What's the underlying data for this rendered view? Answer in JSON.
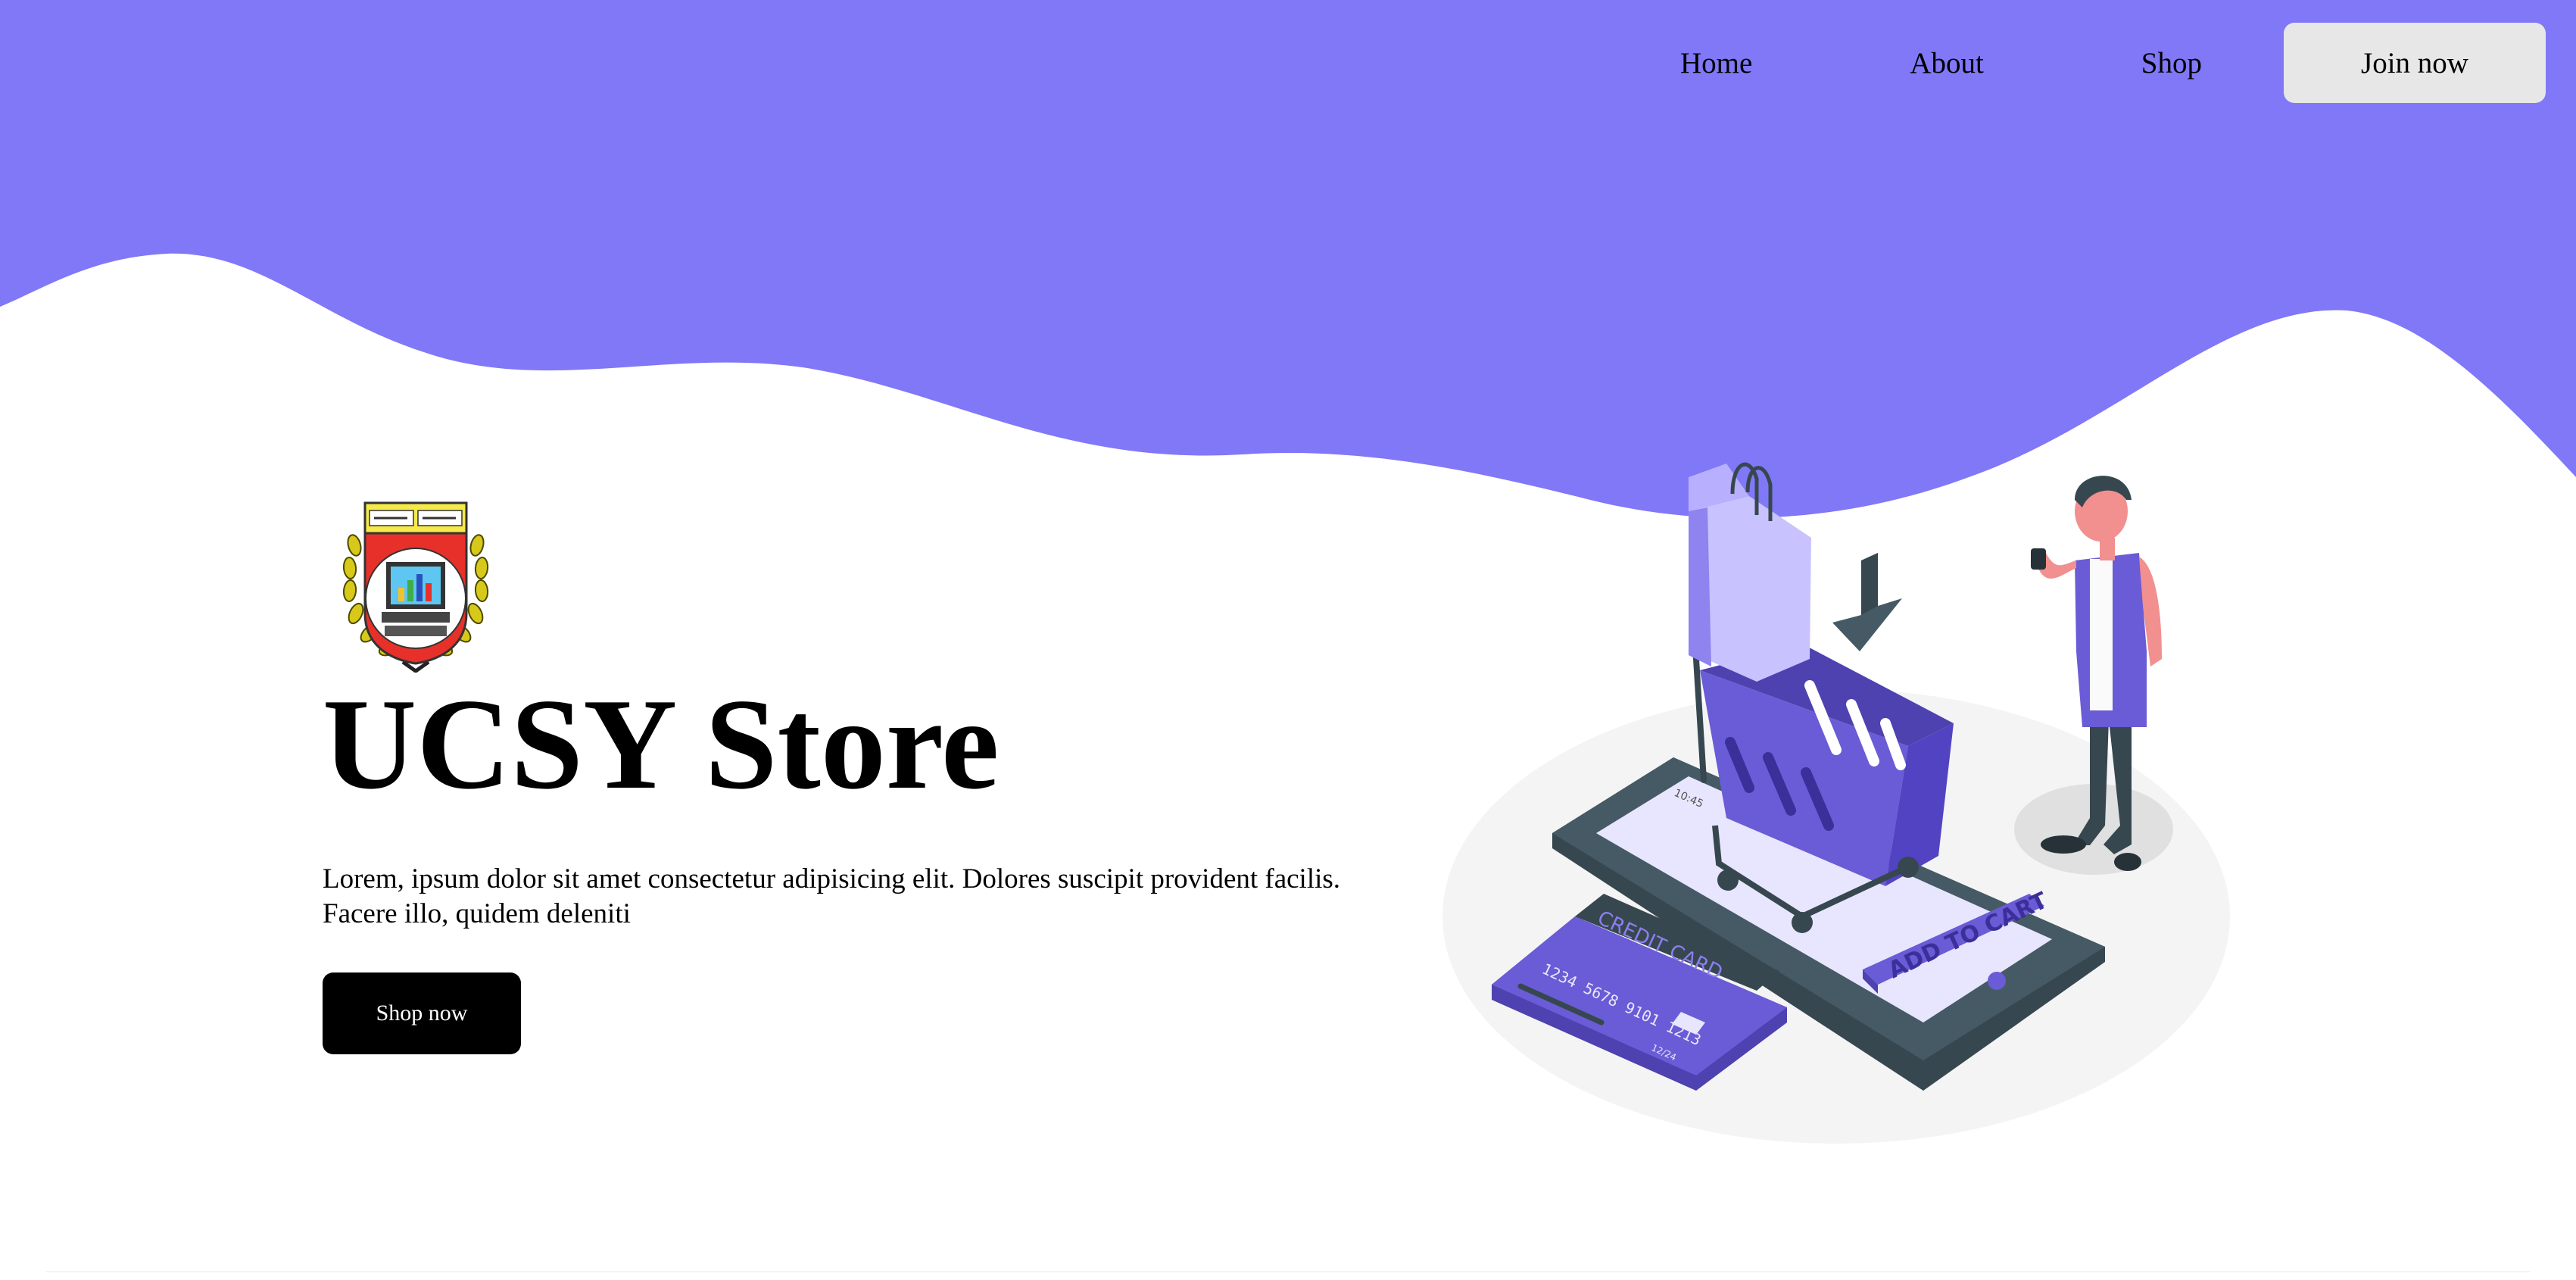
{
  "colors": {
    "brand_purple": "#8078f7",
    "button_black": "#000000",
    "join_button_bg": "#e7e7e7",
    "illustration_purple": "#6a5bd6",
    "illustration_dark": "#37474f"
  },
  "nav": {
    "links": [
      "Home",
      "About",
      "Shop"
    ],
    "join_label": "Join now"
  },
  "hero": {
    "logo_icon": "ucsy-crest-logo",
    "title": "UCSY Store",
    "description": "Lorem, ipsum dolor sit amet consectetur adipisicing elit. Dolores suscipit provident facilis. Facere illo, quidem deleniti",
    "cta_label": "Shop now"
  },
  "illustration": {
    "icon": "online-shopping-illustration",
    "card_label": "CREDIT CARD",
    "card_number": "1234 5678 9101 1213",
    "card_expiry": "12/24",
    "phone_time": "10:45",
    "cart_button_label": "ADD TO CART"
  }
}
